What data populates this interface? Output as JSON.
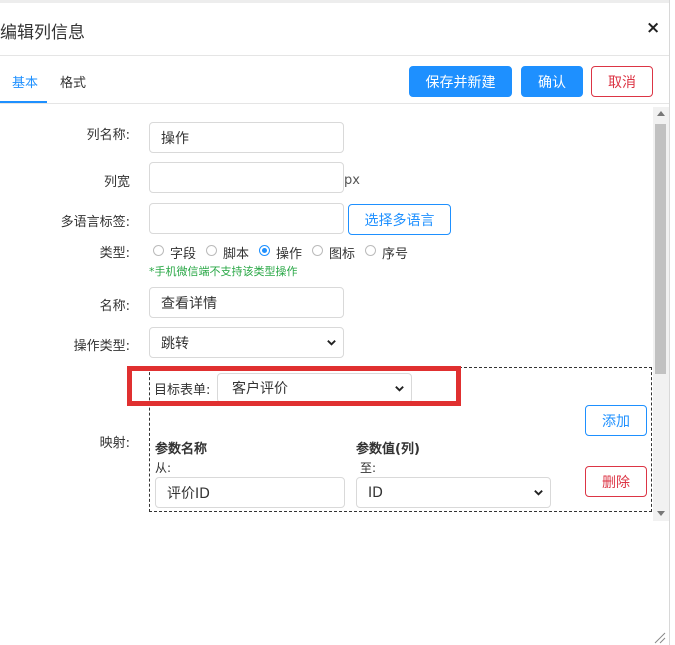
{
  "dialog": {
    "title": "编辑列信息",
    "close_icon": "×"
  },
  "tabs": [
    {
      "label": "基本"
    },
    {
      "label": "格式"
    }
  ],
  "actions": {
    "save_new": "保存并新建",
    "confirm": "确认",
    "cancel": "取消"
  },
  "form": {
    "column_name": {
      "label": "列名称:",
      "value": "操作"
    },
    "column_width": {
      "label": "列宽",
      "value": "",
      "unit": "px"
    },
    "multilang": {
      "label": "多语言标签:",
      "value": "",
      "button": "选择多语言"
    },
    "type": {
      "label": "类型:",
      "options": [
        "字段",
        "脚本",
        "操作",
        "图标",
        "序号"
      ],
      "selected": "操作",
      "hint": "*手机微信端不支持该类型操作"
    },
    "name": {
      "label": "名称:",
      "value": "查看详情"
    },
    "action_type": {
      "label": "操作类型:",
      "value": "跳转"
    },
    "mapping": {
      "label": "映射:",
      "target_form_label": "目标表单:",
      "target_form_value": "客户评价",
      "add_button": "添加",
      "delete_button": "删除",
      "param_name_header": "参数名称",
      "param_value_header": "参数值(列)",
      "from_label": "从:",
      "to_label": "至:",
      "param_name_value": "评价ID",
      "param_value_value": "ID"
    }
  },
  "colors": {
    "primary": "#1e90ff",
    "danger": "#dc3545",
    "hint": "#28a745",
    "highlight": "#e03030"
  }
}
